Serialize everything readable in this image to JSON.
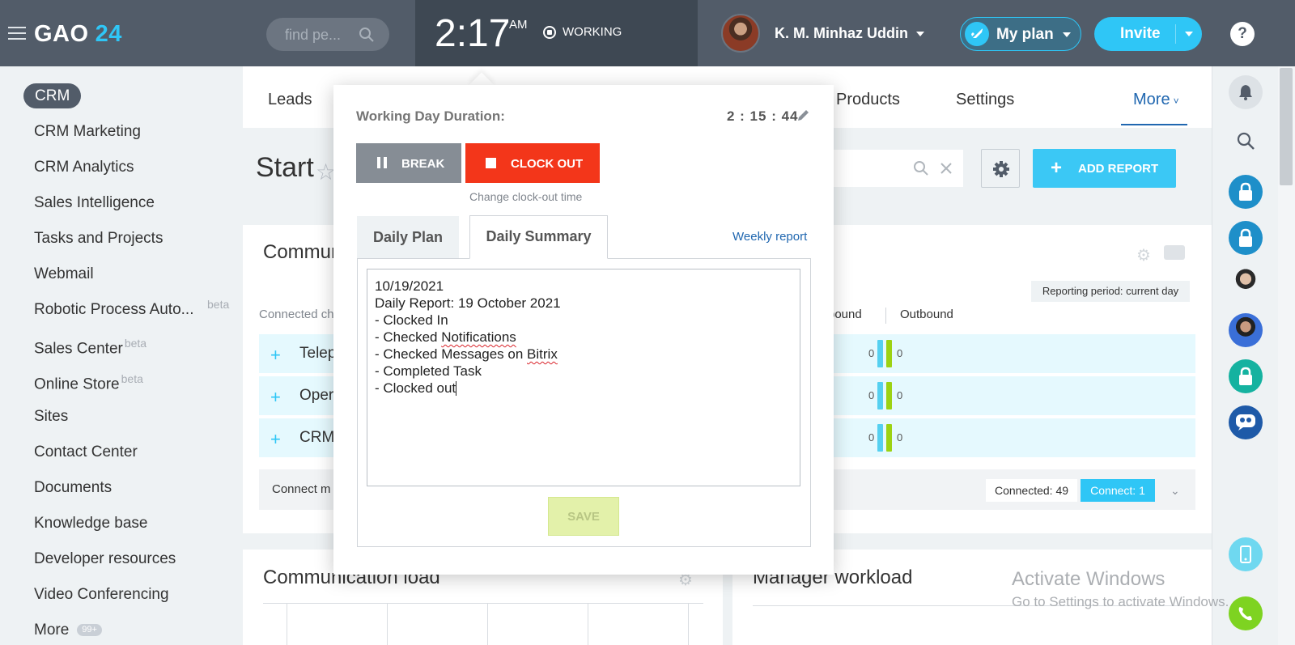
{
  "header": {
    "logo_text": "GAO",
    "logo_num": "24",
    "search_placeholder": "find pe...",
    "clock_time": "2:17",
    "clock_ampm": "AM",
    "status": "WORKING",
    "user_name": "K. M. Minhaz Uddin",
    "myplan_label": "My plan",
    "invite_label": "Invite",
    "help_label": "?"
  },
  "sidebar": {
    "active": "CRM",
    "items": [
      {
        "label": "CRM Marketing"
      },
      {
        "label": "CRM Analytics"
      },
      {
        "label": "Sales Intelligence"
      },
      {
        "label": "Tasks and Projects"
      },
      {
        "label": "Webmail"
      },
      {
        "label": "Robotic Process Auto..."
      },
      {
        "label": "Sales Center",
        "badge": "beta"
      },
      {
        "label": "Online Store",
        "badge": "beta"
      },
      {
        "label": "Sites"
      },
      {
        "label": "Contact Center"
      },
      {
        "label": "Documents"
      },
      {
        "label": "Knowledge base"
      },
      {
        "label": "Developer resources"
      },
      {
        "label": "Video Conferencing"
      },
      {
        "label": "More",
        "count": "99+"
      }
    ],
    "rpa_badge": "beta"
  },
  "nav": {
    "leads": "Leads",
    "products": "Products",
    "settings": "Settings",
    "more": "More"
  },
  "main": {
    "page_title": "Start",
    "add_report": "ADD REPORT",
    "card1": {
      "title": "Commun",
      "connected_prefix": "Connected ch",
      "inbound": "bound",
      "outbound": "Outbound",
      "period": "Reporting period: current day",
      "rows": [
        {
          "label": "Telep",
          "in": "0",
          "out": "0"
        },
        {
          "label": "Oper",
          "in": "0",
          "out": "0"
        },
        {
          "label": "CRM",
          "in": "0",
          "out": "0"
        }
      ],
      "connect_more": "Connect m",
      "connected": "Connected: 49",
      "connect": "Connect: 1"
    },
    "card2_title": "Communication load",
    "card3_title": "Manager workload"
  },
  "popup": {
    "wd_label": "Working Day Duration:",
    "wd_value": "2 : 15 : 44",
    "break_label": "BREAK",
    "clockout_label": "CLOCK OUT",
    "change_clockout": "Change clock-out time",
    "tab_plan": "Daily Plan",
    "tab_summary": "Daily Summary",
    "weekly_report": "Weekly report",
    "lines": [
      "10/19/2021",
      "Daily Report: 19 October 2021",
      "- Clocked In",
      "- Checked Notifications",
      "- Checked Messages on Bitrix",
      "- Completed Task",
      "- Clocked out"
    ],
    "save_label": "SAVE"
  },
  "watermark": {
    "line1": "Activate Windows",
    "line2": "Go to Settings to activate Windows."
  },
  "colors": {
    "header_bg": "#525c69",
    "accent": "#2fc6f6",
    "clockout_red": "#f3361a",
    "link_blue": "#2067b0"
  }
}
